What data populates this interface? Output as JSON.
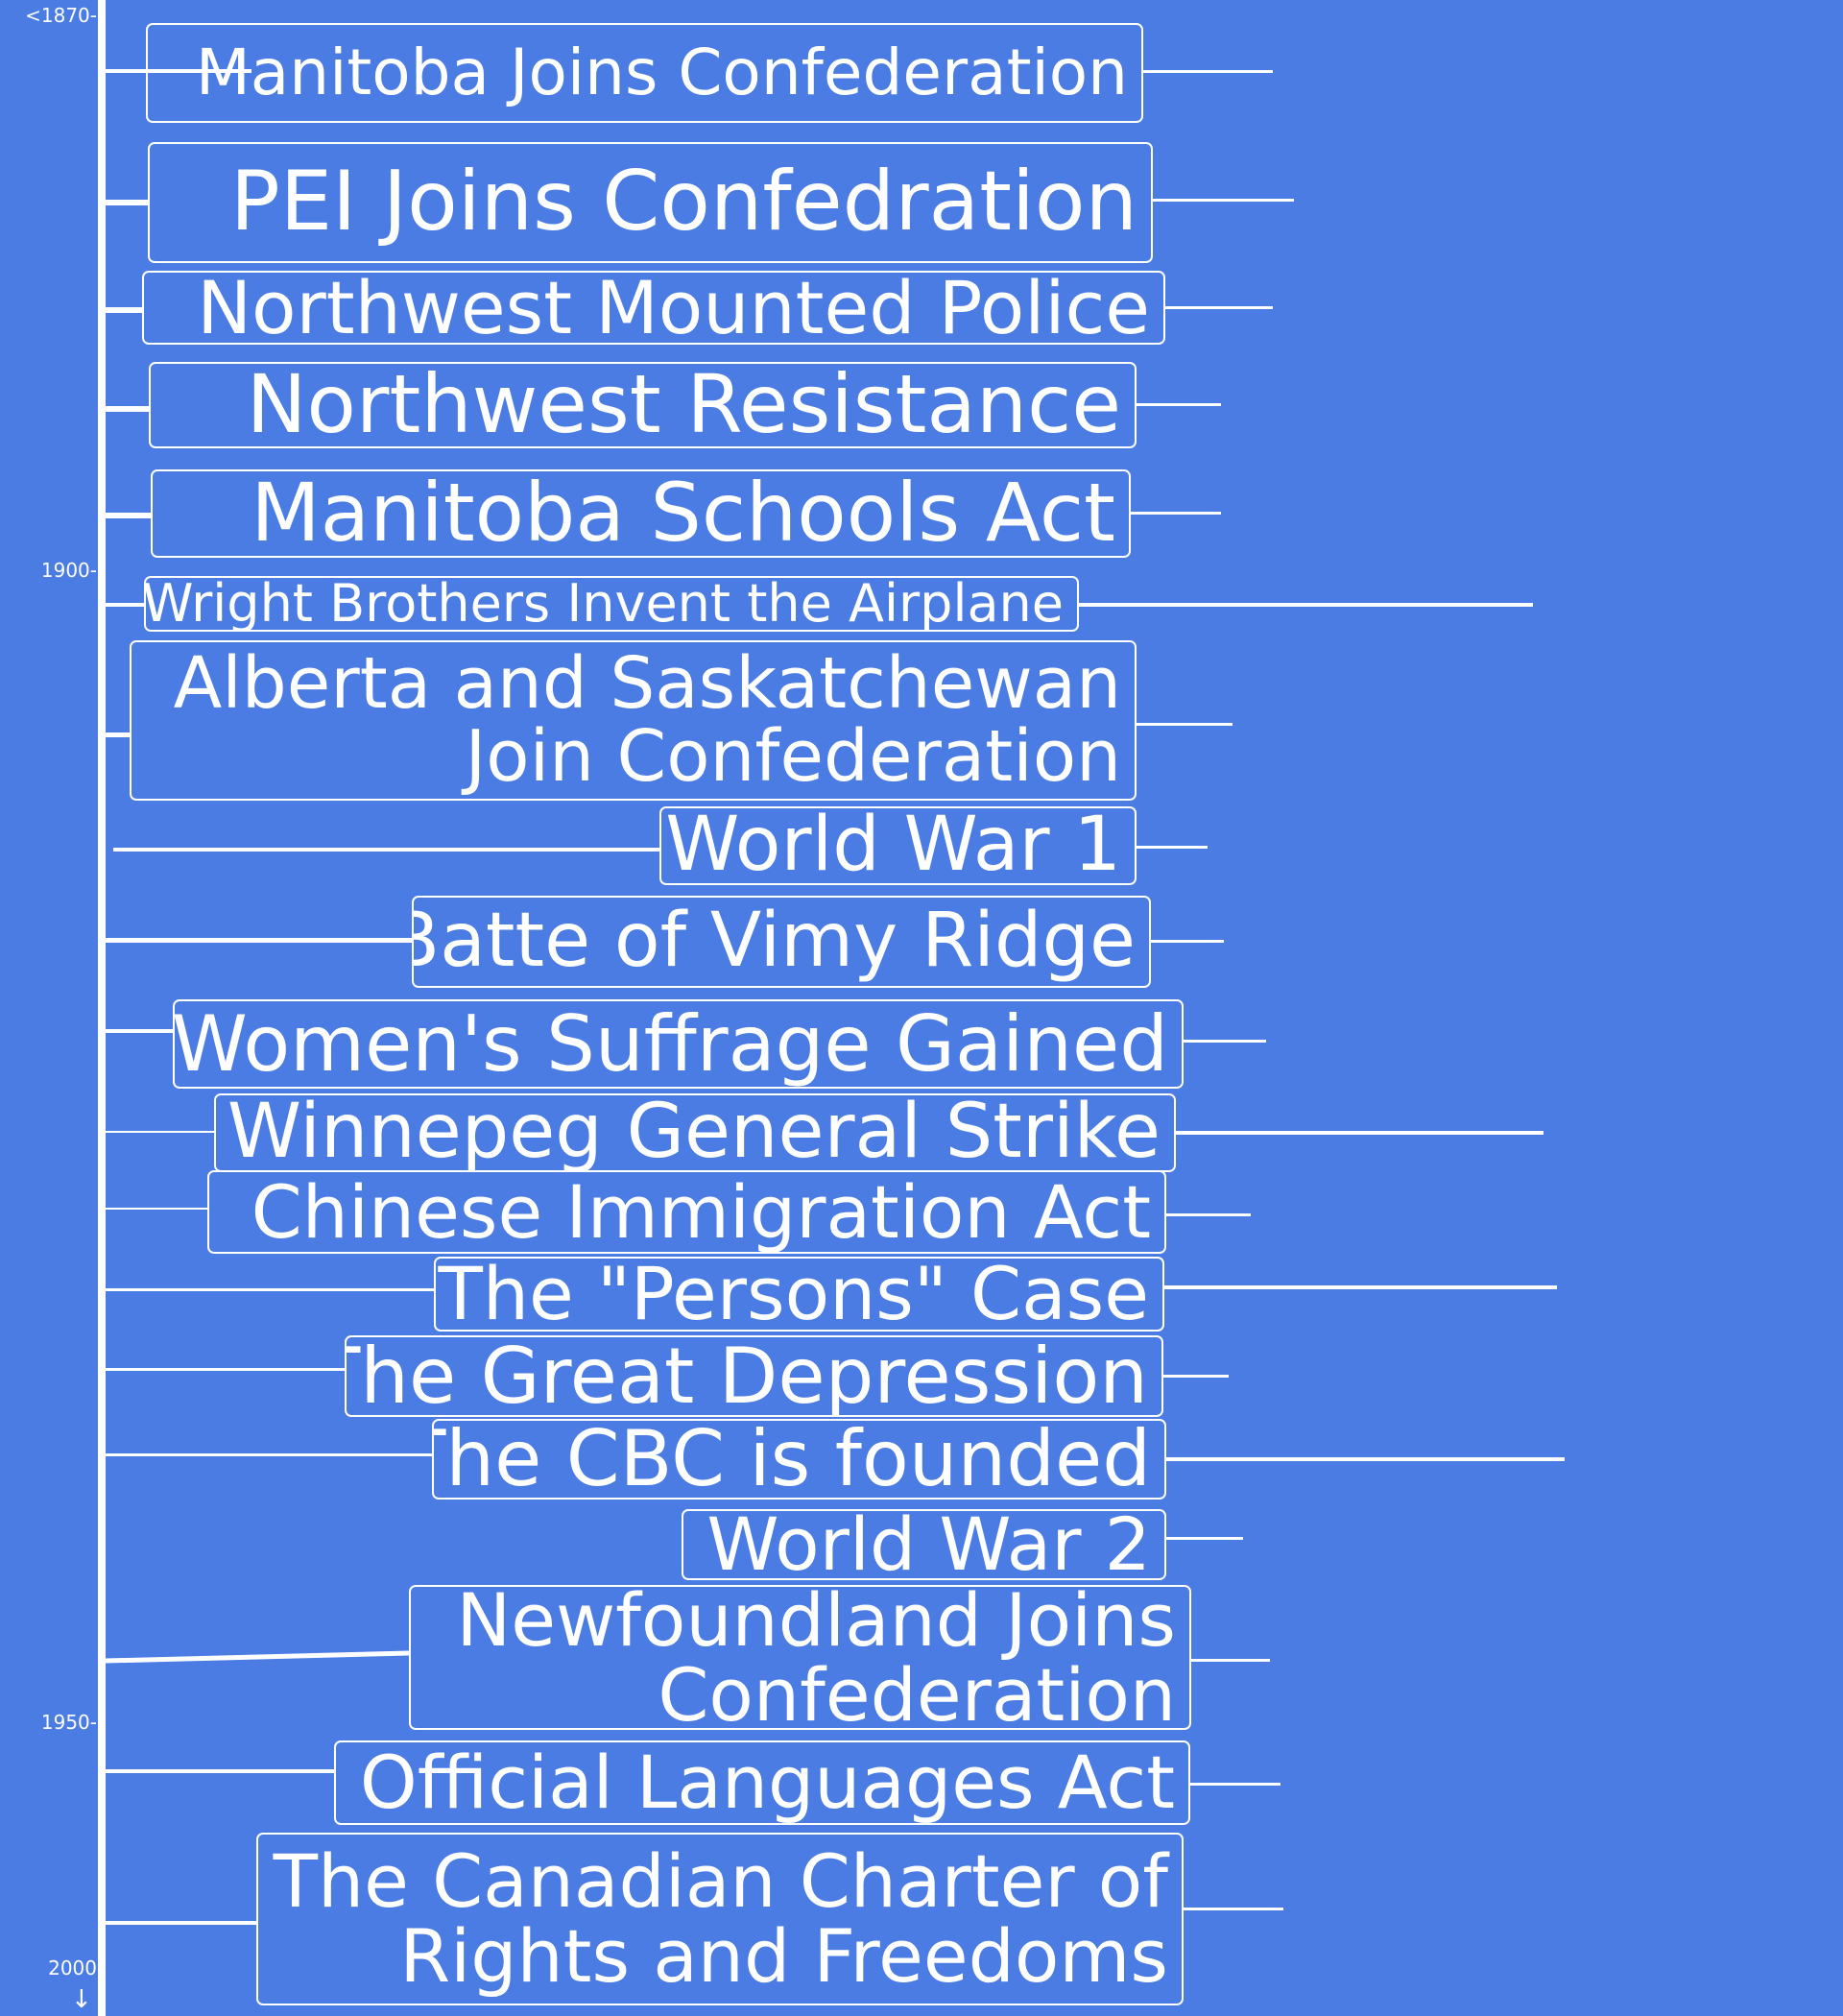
{
  "axis": {
    "ticks": [
      "<1870-",
      "1900-",
      "1950-",
      "2000"
    ],
    "arrow": "↓"
  },
  "events": [
    {
      "lines": [
        "Manitoba Joins Confederation"
      ]
    },
    {
      "lines": [
        "PEI Joins Confedration"
      ]
    },
    {
      "lines": [
        "Northwest Mounted Police"
      ]
    },
    {
      "lines": [
        "Northwest Resistance"
      ]
    },
    {
      "lines": [
        "Manitoba Schools Act"
      ]
    },
    {
      "lines": [
        "Wright Brothers Invent the Airplane"
      ]
    },
    {
      "lines": [
        "Alberta and Saskatchewan",
        "Join Confederation"
      ]
    },
    {
      "lines": [
        "World War 1"
      ]
    },
    {
      "lines": [
        "Batte of Vimy Ridge"
      ]
    },
    {
      "lines": [
        "Women's Suffrage Gained"
      ]
    },
    {
      "lines": [
        "Winnepeg General Strike"
      ]
    },
    {
      "lines": [
        "Chinese Immigration Act"
      ]
    },
    {
      "lines": [
        "The \"Persons\" Case"
      ]
    },
    {
      "lines": [
        "The Great Depression"
      ]
    },
    {
      "lines": [
        "The CBC is founded"
      ]
    },
    {
      "lines": [
        "World War 2"
      ]
    },
    {
      "lines": [
        "Newfoundland Joins",
        "Confederation"
      ]
    },
    {
      "lines": [
        "Official Languages Act"
      ]
    },
    {
      "lines": [
        "The Canadian Charter of",
        "Rights and Freedoms"
      ]
    }
  ]
}
